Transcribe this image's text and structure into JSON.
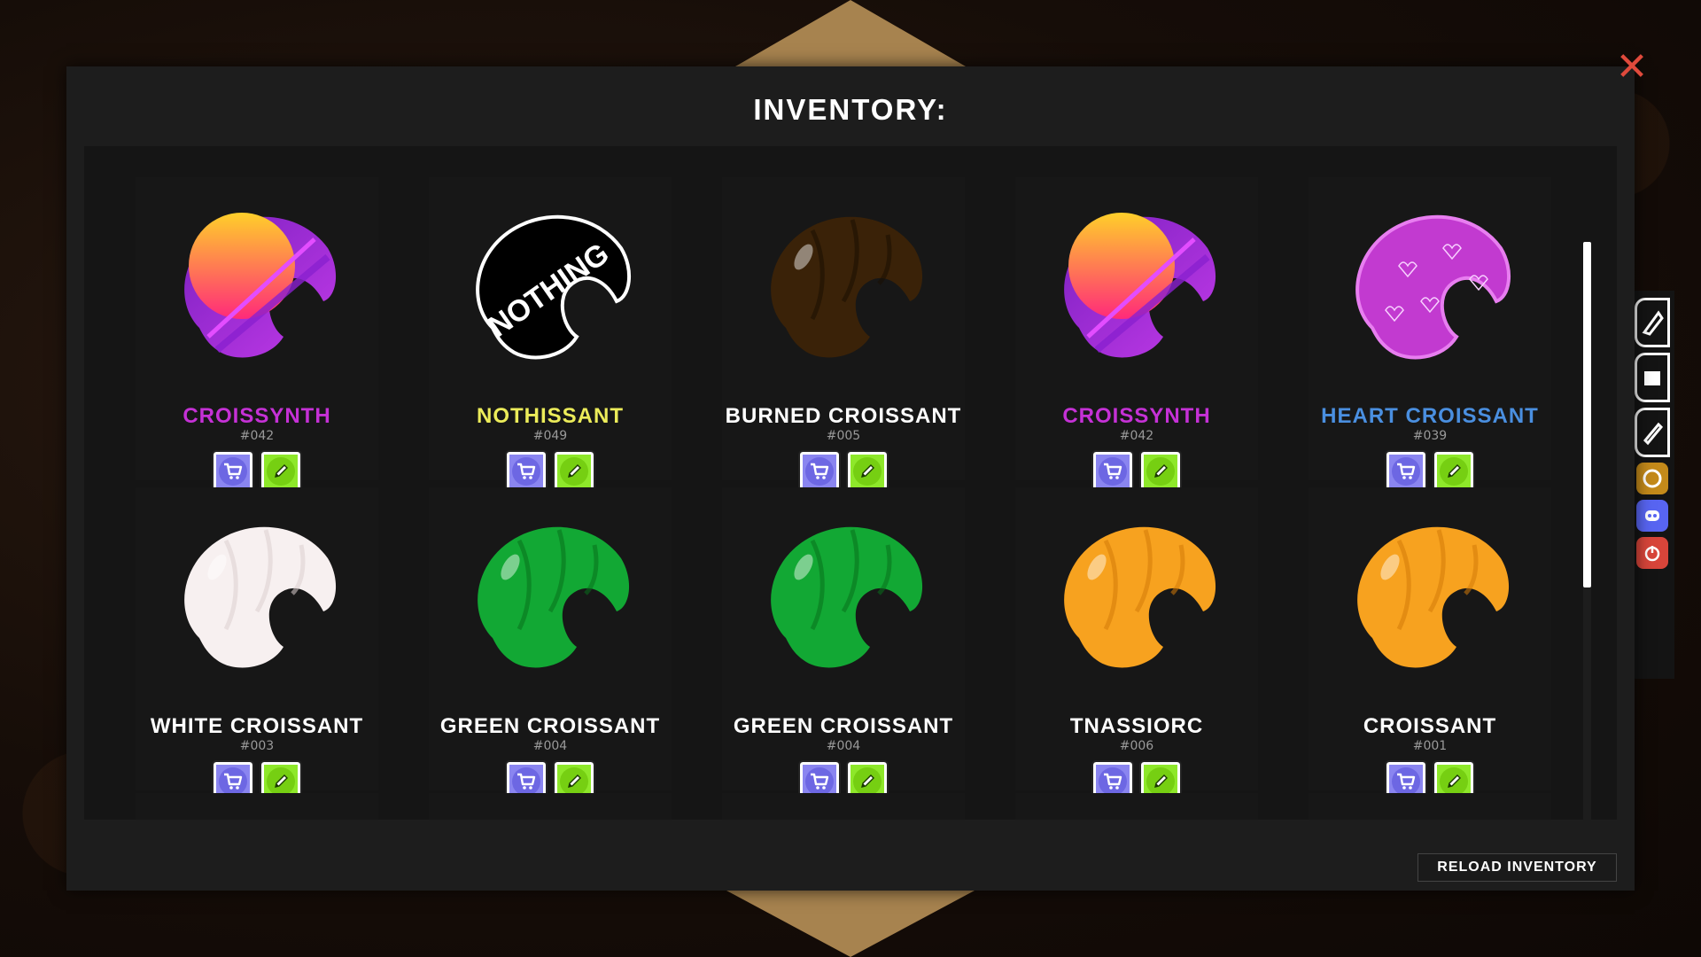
{
  "title": "INVENTORY:",
  "close_icon": "close-icon",
  "reload_label": "RELOAD INVENTORY",
  "colors": {
    "purple_name": "#c531d6",
    "yellow_name": "#ecec5a",
    "blue_name": "#4a8fe0",
    "white_name": "#ffffff",
    "sell_button": "#8a85f0",
    "edit_button": "#8ee82a",
    "close": "#e04a3c"
  },
  "items": [
    {
      "name": "CROISSYNTH",
      "id": "#042",
      "color": "#c531d6",
      "art": "synth"
    },
    {
      "name": "NOTHISSANT",
      "id": "#049",
      "color": "#ecec5a",
      "art": "nothing"
    },
    {
      "name": "BURNED CROISSANT",
      "id": "#005",
      "color": "#ffffff",
      "art": "burned"
    },
    {
      "name": "CROISSYNTH",
      "id": "#042",
      "color": "#c531d6",
      "art": "synth"
    },
    {
      "name": "HEART CROISSANT",
      "id": "#039",
      "color": "#4a8fe0",
      "art": "heart"
    },
    {
      "name": "WHITE CROISSANT",
      "id": "#003",
      "color": "#ffffff",
      "art": "white"
    },
    {
      "name": "GREEN CROISSANT",
      "id": "#004",
      "color": "#ffffff",
      "art": "green"
    },
    {
      "name": "GREEN CROISSANT",
      "id": "#004",
      "color": "#ffffff",
      "art": "green"
    },
    {
      "name": "TNASSIORC",
      "id": "#006",
      "color": "#ffffff",
      "art": "orange"
    },
    {
      "name": "CROISSANT",
      "id": "#001",
      "color": "#ffffff",
      "art": "orange"
    }
  ],
  "dock": [
    "croissant-icon",
    "shop-icon",
    "pencil-icon",
    "leaderboard-icon",
    "discord-icon",
    "power-icon"
  ]
}
